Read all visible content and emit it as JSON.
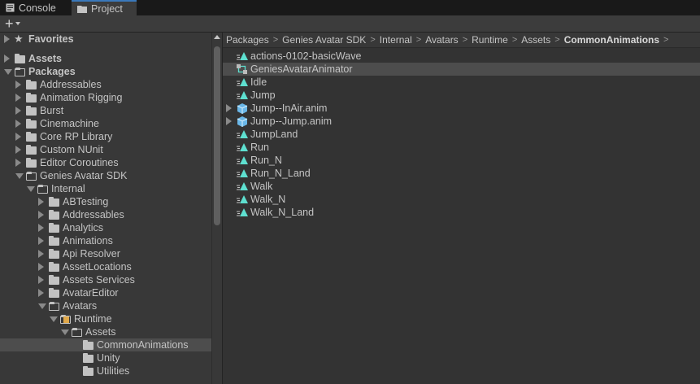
{
  "tabs": [
    {
      "label": "Console",
      "icon": "console-icon"
    },
    {
      "label": "Project",
      "icon": "folder-icon",
      "active": true
    }
  ],
  "toolbar": {
    "add_label": "+"
  },
  "tree": [
    {
      "label": "Favorites",
      "depth": 0,
      "state": "closed",
      "icon": "star",
      "bold": true
    },
    {
      "label": "",
      "depth": 0,
      "state": "none",
      "icon": "none"
    },
    {
      "label": "Assets",
      "depth": 0,
      "state": "closed",
      "icon": "folder",
      "bold": true
    },
    {
      "label": "Packages",
      "depth": 0,
      "state": "open",
      "icon": "folder-open",
      "bold": true
    },
    {
      "label": "Addressables",
      "depth": 1,
      "state": "closed",
      "icon": "folder"
    },
    {
      "label": "Animation Rigging",
      "depth": 1,
      "state": "closed",
      "icon": "folder"
    },
    {
      "label": "Burst",
      "depth": 1,
      "state": "closed",
      "icon": "folder"
    },
    {
      "label": "Cinemachine",
      "depth": 1,
      "state": "closed",
      "icon": "folder"
    },
    {
      "label": "Core RP Library",
      "depth": 1,
      "state": "closed",
      "icon": "folder"
    },
    {
      "label": "Custom NUnit",
      "depth": 1,
      "state": "closed",
      "icon": "folder"
    },
    {
      "label": "Editor Coroutines",
      "depth": 1,
      "state": "closed",
      "icon": "folder"
    },
    {
      "label": "Genies Avatar SDK",
      "depth": 1,
      "state": "open",
      "icon": "folder-open"
    },
    {
      "label": "Internal",
      "depth": 2,
      "state": "open",
      "icon": "folder-open"
    },
    {
      "label": "ABTesting",
      "depth": 3,
      "state": "closed",
      "icon": "folder"
    },
    {
      "label": "Addressables",
      "depth": 3,
      "state": "closed",
      "icon": "folder"
    },
    {
      "label": "Analytics",
      "depth": 3,
      "state": "closed",
      "icon": "folder"
    },
    {
      "label": "Animations",
      "depth": 3,
      "state": "closed",
      "icon": "folder"
    },
    {
      "label": "Api Resolver",
      "depth": 3,
      "state": "closed",
      "icon": "folder"
    },
    {
      "label": "AssetLocations",
      "depth": 3,
      "state": "closed",
      "icon": "folder"
    },
    {
      "label": "Assets Services",
      "depth": 3,
      "state": "closed",
      "icon": "folder"
    },
    {
      "label": "AvatarEditor",
      "depth": 3,
      "state": "closed",
      "icon": "folder"
    },
    {
      "label": "Avatars",
      "depth": 3,
      "state": "open",
      "icon": "folder-open"
    },
    {
      "label": "Runtime",
      "depth": 4,
      "state": "open",
      "icon": "folder-open-script"
    },
    {
      "label": "Assets",
      "depth": 5,
      "state": "open",
      "icon": "folder-open"
    },
    {
      "label": "CommonAnimations",
      "depth": 6,
      "state": "none",
      "icon": "folder",
      "selected": true
    },
    {
      "label": "Unity",
      "depth": 6,
      "state": "none",
      "icon": "folder"
    },
    {
      "label": "Utilities",
      "depth": 6,
      "state": "none",
      "icon": "folder"
    }
  ],
  "breadcrumb": [
    "Packages",
    "Genies Avatar SDK",
    "Internal",
    "Avatars",
    "Runtime",
    "Assets",
    "CommonAnimations"
  ],
  "files": [
    {
      "label": "actions-0102-basicWave",
      "type": "anim"
    },
    {
      "label": "GeniesAvatarAnimator",
      "type": "controller",
      "selected": true
    },
    {
      "label": "Idle",
      "type": "anim"
    },
    {
      "label": "Jump",
      "type": "anim"
    },
    {
      "label": "Jump--InAir.anim",
      "type": "model",
      "expandable": true
    },
    {
      "label": "Jump--Jump.anim",
      "type": "model",
      "expandable": true
    },
    {
      "label": "JumpLand",
      "type": "anim"
    },
    {
      "label": "Run",
      "type": "anim"
    },
    {
      "label": "Run_N",
      "type": "anim"
    },
    {
      "label": "Run_N_Land",
      "type": "anim"
    },
    {
      "label": "Walk",
      "type": "anim"
    },
    {
      "label": "Walk_N",
      "type": "anim"
    },
    {
      "label": "Walk_N_Land",
      "type": "anim"
    }
  ],
  "colors": {
    "accent": "#3a79bb",
    "anim": "#5ee0d0",
    "model": "#6ab7e8"
  }
}
